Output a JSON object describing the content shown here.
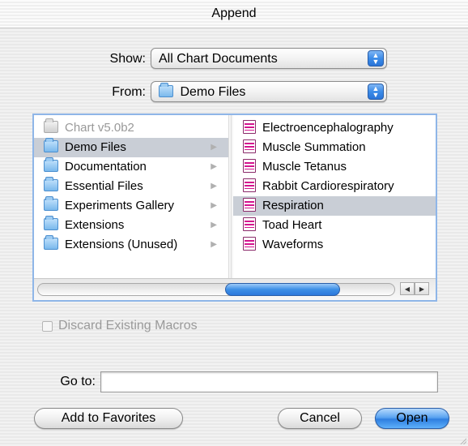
{
  "window": {
    "title": "Append"
  },
  "show": {
    "label": "Show:",
    "value": "All Chart Documents"
  },
  "from": {
    "label": "From:",
    "value": "Demo Files"
  },
  "browser": {
    "column1": [
      {
        "name": "Chart v5.0b2",
        "icon": "app-icon",
        "dimmed": true,
        "has_children": false,
        "selected": false
      },
      {
        "name": "Demo Files",
        "icon": "folder-icon",
        "has_children": true,
        "selected": true
      },
      {
        "name": "Documentation",
        "icon": "folder-icon",
        "has_children": true,
        "selected": false
      },
      {
        "name": "Essential Files",
        "icon": "folder-icon",
        "has_children": true,
        "selected": false
      },
      {
        "name": "Experiments Gallery",
        "icon": "folder-icon",
        "has_children": true,
        "selected": false
      },
      {
        "name": "Extensions",
        "icon": "folder-icon",
        "has_children": true,
        "selected": false
      },
      {
        "name": "Extensions (Unused)",
        "icon": "folder-icon",
        "has_children": true,
        "selected": false
      }
    ],
    "column2": [
      {
        "name": "Electroencephalography",
        "icon": "chart-document-icon",
        "selected": false
      },
      {
        "name": "Muscle Summation",
        "icon": "chart-document-icon",
        "selected": false
      },
      {
        "name": "Muscle Tetanus",
        "icon": "chart-document-icon",
        "selected": false
      },
      {
        "name": "Rabbit Cardiorespiratory",
        "icon": "chart-document-icon",
        "selected": false
      },
      {
        "name": "Respiration",
        "icon": "chart-document-icon",
        "selected": true
      },
      {
        "name": "Toad Heart",
        "icon": "chart-document-icon",
        "selected": false
      },
      {
        "name": "Waveforms",
        "icon": "chart-document-icon",
        "selected": false
      }
    ]
  },
  "discard_macros": {
    "label": "Discard Existing Macros",
    "checked": false,
    "enabled": false
  },
  "goto": {
    "label": "Go to:",
    "value": ""
  },
  "buttons": {
    "add_favorites": "Add to Favorites",
    "cancel": "Cancel",
    "open": "Open"
  },
  "colors": {
    "accent": "#3c8ce8",
    "selection": "#c9ced6",
    "doc_icon": "#d4148f"
  }
}
